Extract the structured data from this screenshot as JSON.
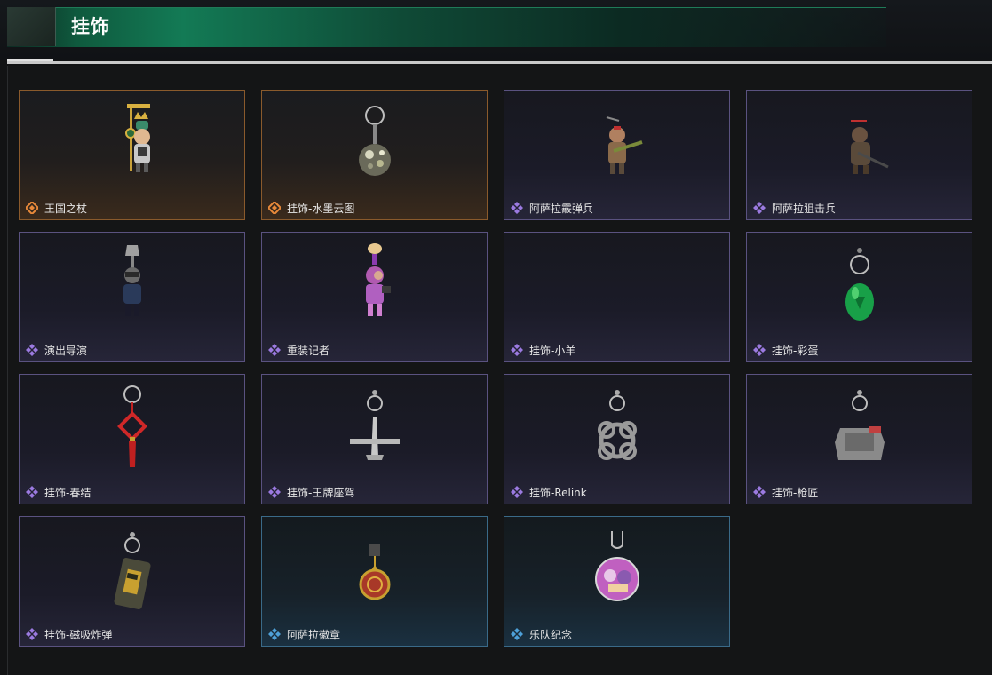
{
  "header": {
    "title": "挂饰"
  },
  "colors": {
    "gold": "#e8893a",
    "purple": "#9b7ae0",
    "blue": "#4ea0d8"
  },
  "items": [
    {
      "label": "王国之杖",
      "rarity": "gold",
      "icon": "scepter-figure-icon"
    },
    {
      "label": "挂饰-水墨云图",
      "rarity": "gold",
      "icon": "ink-orb-icon"
    },
    {
      "label": "阿萨拉霰弹兵",
      "rarity": "purple",
      "icon": "shotgunner-figure-icon"
    },
    {
      "label": "阿萨拉狙击兵",
      "rarity": "purple",
      "icon": "sniper-figure-icon"
    },
    {
      "label": "演出导演",
      "rarity": "purple",
      "icon": "director-figure-icon"
    },
    {
      "label": "重装记者",
      "rarity": "purple",
      "icon": "reporter-figure-icon"
    },
    {
      "label": "挂饰-小羊",
      "rarity": "purple",
      "icon": ""
    },
    {
      "label": "挂饰-彩蛋",
      "rarity": "purple",
      "icon": "green-egg-icon"
    },
    {
      "label": "挂饰-春结",
      "rarity": "purple",
      "icon": "chinese-knot-icon"
    },
    {
      "label": "挂饰-王牌座驾",
      "rarity": "purple",
      "icon": "jet-plane-icon"
    },
    {
      "label": "挂饰-Relink",
      "rarity": "purple",
      "icon": "relink-logo-icon"
    },
    {
      "label": "挂饰-枪匠",
      "rarity": "purple",
      "icon": "gunsmith-box-icon"
    },
    {
      "label": "挂饰-磁吸炸弹",
      "rarity": "purple",
      "icon": "magnetic-bomb-icon"
    },
    {
      "label": "阿萨拉徽章",
      "rarity": "blue",
      "icon": "badge-medallion-icon"
    },
    {
      "label": "乐队纪念",
      "rarity": "blue",
      "icon": "band-pin-icon"
    }
  ]
}
